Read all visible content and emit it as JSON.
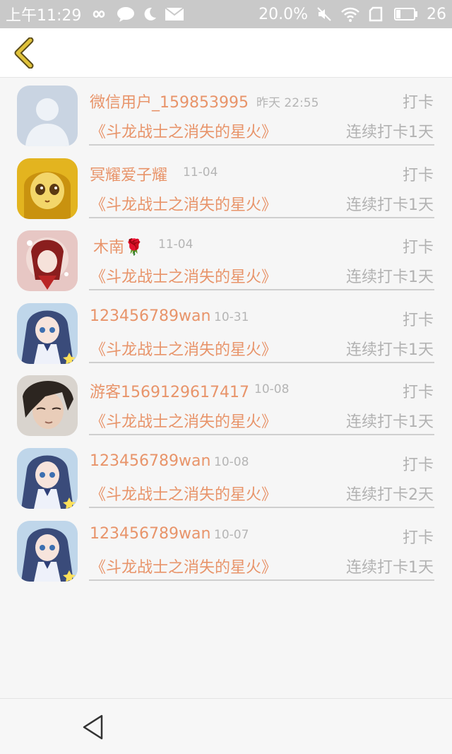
{
  "status_bar": {
    "time": "上午11:29",
    "battery_text": "20.0%",
    "battery_level": "26",
    "icons": [
      "infinity-icon",
      "chat-icon",
      "moon-icon",
      "mail-icon",
      "mute-icon",
      "wifi-icon",
      "sim-icon",
      "battery-icon"
    ]
  },
  "header": {
    "back_icon": "chevron-left-icon",
    "accent": "#e0c23a"
  },
  "colors": {
    "name": "#e8946a",
    "muted": "#b2b2b2",
    "divider": "#cfcfcf"
  },
  "items": [
    {
      "name": "微信用户_159853995",
      "date": "昨天 22:55",
      "action": "打卡",
      "book": "《斗龙战士之消失的星火》",
      "streak": "连续打卡1天",
      "avatar": "default-user"
    },
    {
      "name": "冥耀爱子耀",
      "date": "11-04",
      "action": "打卡",
      "book": "《斗龙战士之消失的星火》",
      "streak": "连续打卡1天",
      "avatar": "yellow-cartoon"
    },
    {
      "name": "木南🌹",
      "date": "11-04",
      "action": "打卡",
      "book": "《斗龙战士之消失的星火》",
      "streak": "连续打卡1天",
      "avatar": "red-anime"
    },
    {
      "name": "123456789wan",
      "date": "10-31",
      "action": "打卡",
      "book": "《斗龙战士之消失的星火》",
      "streak": "连续打卡1天",
      "avatar": "anime-girl"
    },
    {
      "name": "游客1569129617417",
      "date": "10-08",
      "action": "打卡",
      "book": "《斗龙战士之消失的星火》",
      "streak": "连续打卡1天",
      "avatar": "dark-hair-boy"
    },
    {
      "name": "123456789wan",
      "date": "10-08",
      "action": "打卡",
      "book": "《斗龙战士之消失的星火》",
      "streak": "连续打卡2天",
      "avatar": "anime-girl"
    },
    {
      "name": "123456789wan",
      "date": "10-07",
      "action": "打卡",
      "book": "《斗龙战士之消失的星火》",
      "streak": "连续打卡1天",
      "avatar": "anime-girl"
    }
  ],
  "nav_bar": {
    "back_icon": "triangle-back-icon"
  }
}
